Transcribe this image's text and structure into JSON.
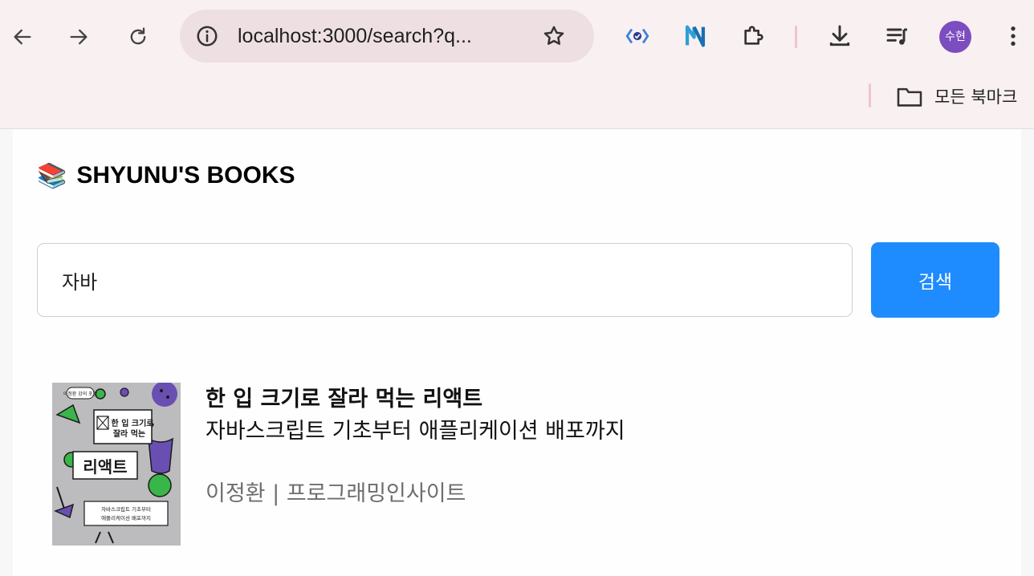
{
  "browser": {
    "url": "localhost:3000/search?q...",
    "profile_initials": "수현",
    "bookmarks_label": "모든 북마크",
    "icons": [
      "back-icon",
      "forward-icon",
      "reload-icon",
      "site-info-icon",
      "bookmark-star-icon",
      "react-devtools-icon",
      "netlify-icon",
      "extensions-icon",
      "downloads-icon",
      "media-controls-icon",
      "menu-icon",
      "folder-icon"
    ]
  },
  "header": {
    "logo_emoji": "📚",
    "title": "SHYUNU'S BOOKS"
  },
  "search": {
    "value": "자바",
    "button_label": "검색"
  },
  "results": [
    {
      "title": "한 입 크기로 잘라 먹는 리액트",
      "subtitle": "자바스크립트 기초부터 애플리케이션 배포까지",
      "author": "이정환",
      "separator": "|",
      "publisher": "프로그래밍인사이트",
      "cover": {
        "badge": "이정환 강의 포함",
        "title_line1": "한 입 크기로",
        "title_line2": "잘라 먹는",
        "big_title": "리액트",
        "desc_line1": "자바스크립트 기초부터",
        "desc_line2": "애플리케이션 배포까지"
      }
    }
  ],
  "colors": {
    "chrome_bg": "#f8f0f1",
    "omnibox_bg": "#eedfe3",
    "primary_button": "#1e8bff",
    "meta_text": "#6e6e6e",
    "avatar": "#7c4dbf"
  }
}
